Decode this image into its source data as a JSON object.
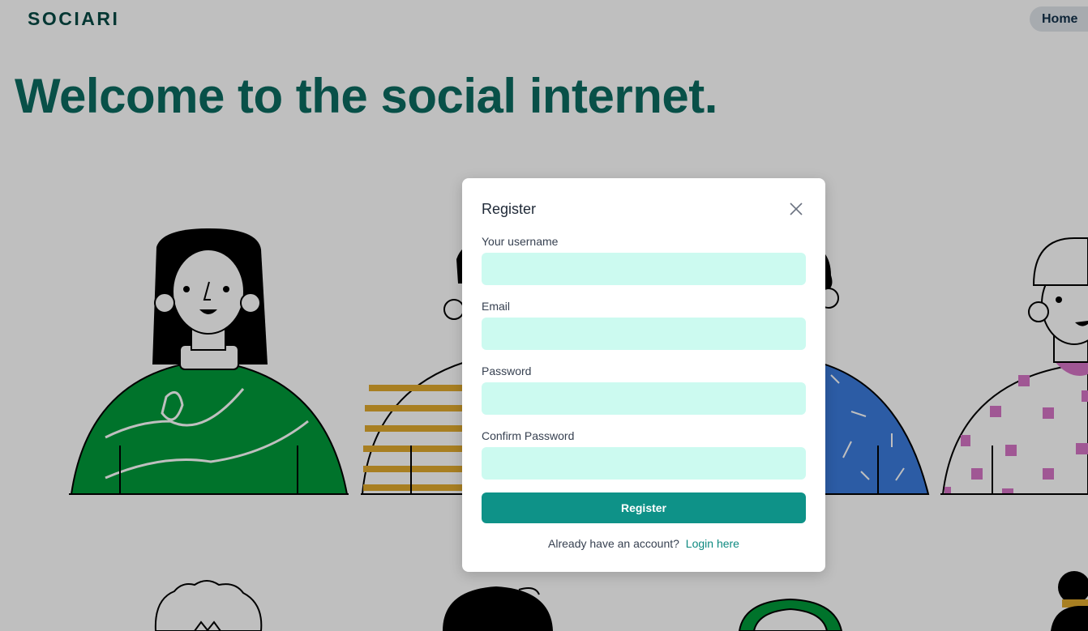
{
  "header": {
    "brand": "SOCIARI",
    "nav_home": "Home"
  },
  "hero": {
    "title": "Welcome to the social internet."
  },
  "modal": {
    "title": "Register",
    "fields": [
      {
        "label": "Your username",
        "value": ""
      },
      {
        "label": "Email",
        "value": ""
      },
      {
        "label": "Password",
        "value": ""
      },
      {
        "label": "Confirm Password",
        "value": ""
      }
    ],
    "submit_label": "Register",
    "footer_text": "Already have an account?",
    "login_link": "Login here"
  },
  "colors": {
    "brand": "#064a45",
    "hero_title": "#0b6b60",
    "input_bg": "#ccfaf0",
    "primary_button": "#0e9288",
    "link": "#0e8a80",
    "overlay": "rgba(0,0,0,0.25)"
  },
  "icons": {
    "close": "close-icon"
  }
}
